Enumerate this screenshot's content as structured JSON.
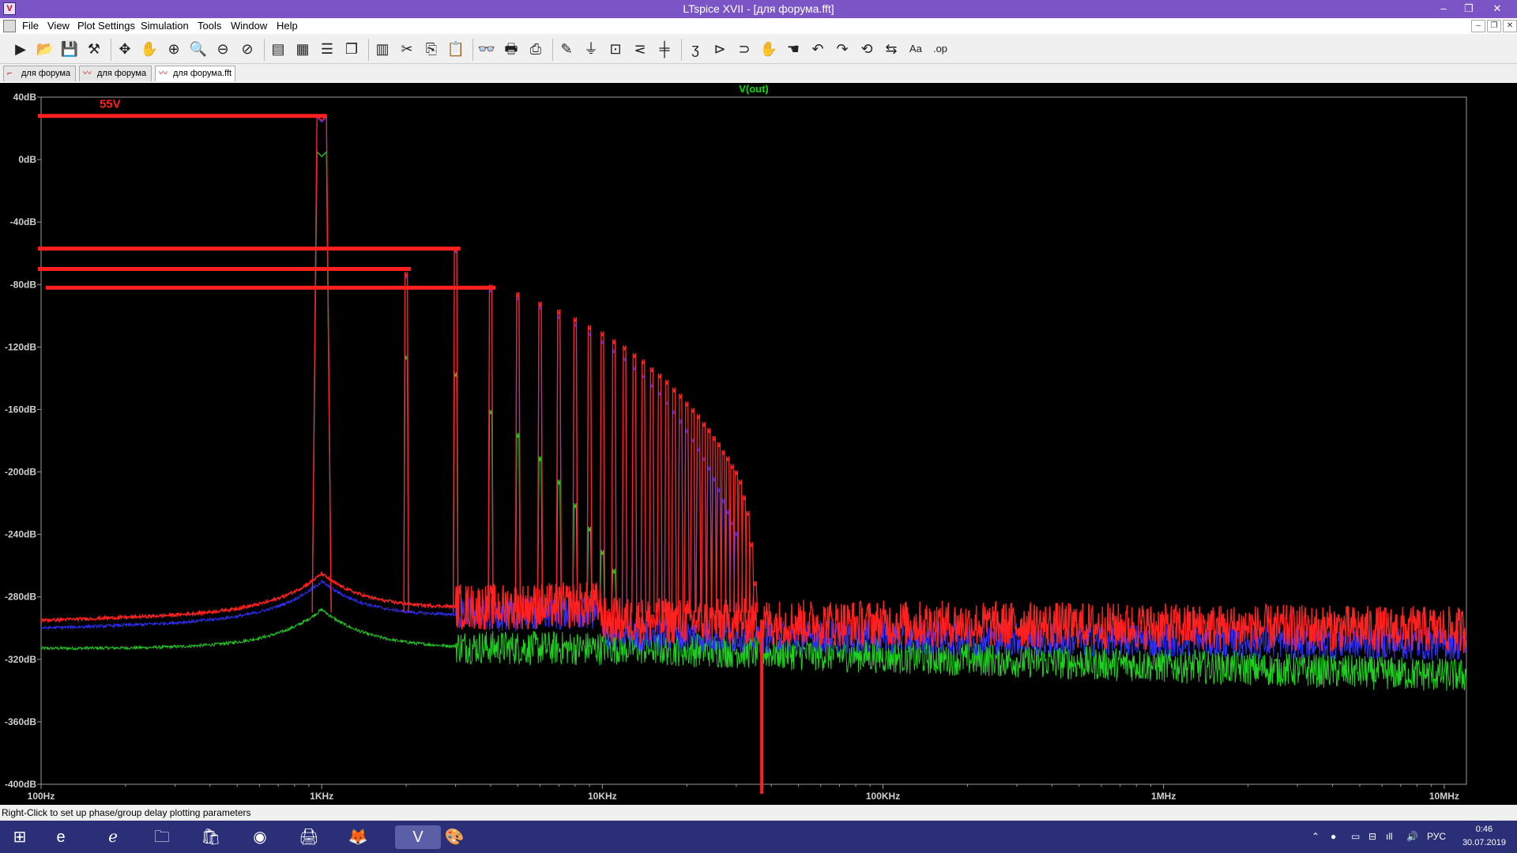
{
  "window": {
    "title": "LTspice XVII - [для форума.fft]",
    "app_icon": "ltspice-icon"
  },
  "menu": [
    "File",
    "View",
    "Plot Settings",
    "Simulation",
    "Tools",
    "Window",
    "Help"
  ],
  "toolbar_icons": [
    "run-icon",
    "open-icon",
    "save-icon",
    "control-panel-icon",
    "autorange-icon",
    "pan-icon",
    "zoom-in-icon",
    "zoom-area-icon",
    "zoom-out-icon",
    "zoom-cancel-icon",
    "plot-pane-icon",
    "plot-setting-icon",
    "tile-h-icon",
    "cascade-icon",
    "tile-v-icon",
    "cut-icon",
    "copy-icon",
    "paste-icon",
    "find-icon",
    "print-icon",
    "print-preview-icon",
    "wire-icon",
    "ground-icon",
    "label-icon",
    "resistor-icon",
    "capacitor-icon",
    "inductor-icon",
    "diode-icon",
    "component-icon",
    "move-icon",
    "drag-icon",
    "undo-icon",
    "redo-icon",
    "rotate-icon",
    "mirror-icon",
    "text-icon",
    "spice-directive-icon"
  ],
  "tabs": [
    {
      "label": "для форума",
      "icon": "schematic-icon"
    },
    {
      "label": "для форума",
      "icon": "waveform-icon"
    },
    {
      "label": "для форума.fft",
      "icon": "waveform-icon",
      "active": true
    }
  ],
  "chart_data": {
    "type": "line",
    "title": "V(out)",
    "xscale": "log",
    "xlim": [
      100,
      12000000
    ],
    "ylim": [
      -400,
      40
    ],
    "x_tick_labels": [
      "100Hz",
      "1KHz",
      "10KHz",
      "100KHz",
      "1MHz",
      "10MHz"
    ],
    "x_ticks": [
      100,
      1000,
      10000,
      100000,
      1000000,
      10000000
    ],
    "y_tick_labels": [
      "40dB",
      "0dB",
      "-40dB",
      "-80dB",
      "-120dB",
      "-160dB",
      "-200dB",
      "-240dB",
      "-280dB",
      "-320dB",
      "-360dB",
      "-400dB"
    ],
    "y_ticks": [
      40,
      0,
      -40,
      -80,
      -120,
      -160,
      -200,
      -240,
      -280,
      -320,
      -360,
      -400
    ],
    "fundamental_hz": 1000,
    "series": [
      {
        "color": "#ff2020",
        "harmonic_peaks_db": [
          28,
          -72,
          -56,
          -80,
          -85,
          -91,
          -96,
          -101,
          -106,
          -110,
          -115,
          -119,
          -124,
          -128,
          -133,
          -137,
          -141,
          -146,
          -150,
          -155,
          -159,
          -163,
          -168,
          -172,
          -177,
          -181,
          -186,
          -190,
          -195,
          -199,
          -205,
          -215,
          -225,
          -245,
          -270
        ],
        "noise_floor_db": -295
      },
      {
        "color": "#3030ff",
        "harmonic_peaks_db": [
          27,
          -73,
          -57,
          -82,
          -87,
          -93,
          -99,
          -104,
          -110,
          -115,
          -121,
          -126,
          -132,
          -137,
          -143,
          -148,
          -154,
          -160,
          -166,
          -172,
          -178,
          -184,
          -190,
          -196,
          -203,
          -210,
          -217,
          -224,
          -231,
          -238
        ],
        "noise_floor_db": -300
      },
      {
        "color": "#20d020",
        "harmonic_peaks_db": [
          5,
          -125,
          -136,
          -160,
          -175,
          -190,
          -205,
          -220,
          -235,
          -250,
          -262
        ],
        "noise_floor_db": -308
      }
    ],
    "annotations": [
      {
        "text": "55V",
        "color": "#ff2020"
      }
    ],
    "marker_lines_db": [
      28,
      -57,
      -70,
      -82
    ]
  },
  "status": "Right-Click to set up phase/group delay plotting parameters",
  "taskbar": {
    "apps": [
      "windows-start-icon",
      "edge-icon",
      "ie-icon",
      "explorer-icon",
      "store-icon",
      "chrome-icon",
      "printer-icon",
      "firefox-icon",
      "ltspice-icon",
      "paint-icon"
    ],
    "tray_lang": "РУС",
    "time": "0:46",
    "date": "30.07.2019"
  }
}
